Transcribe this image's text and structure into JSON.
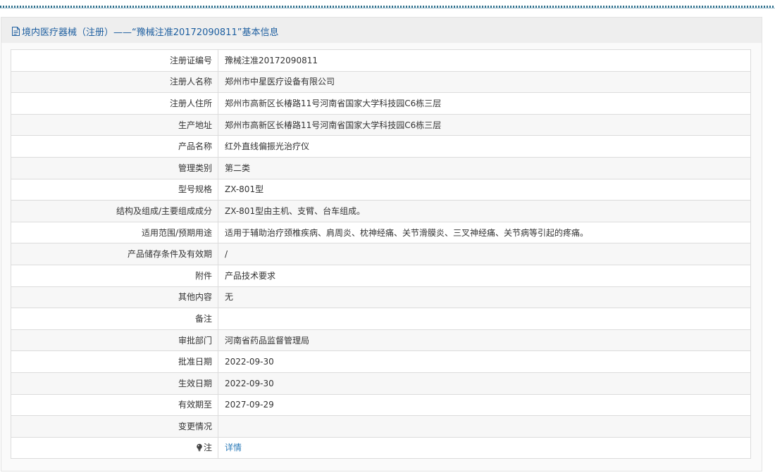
{
  "panel": {
    "title": "境内医疗器械（注册）——“豫械注准20172090811”基本信息",
    "title_icon": "document-icon"
  },
  "rows": [
    {
      "label": "注册证编号",
      "value": "豫械注准20172090811"
    },
    {
      "label": "注册人名称",
      "value": "郑州市中星医疗设备有限公司"
    },
    {
      "label": "注册人住所",
      "value": "郑州市高新区长椿路11号河南省国家大学科技园C6栋三层"
    },
    {
      "label": "生产地址",
      "value": "郑州市高新区长椿路11号河南省国家大学科技园C6栋三层"
    },
    {
      "label": "产品名称",
      "value": "红外直线偏振光治疗仪"
    },
    {
      "label": "管理类别",
      "value": "第二类"
    },
    {
      "label": "型号规格",
      "value": "ZX-801型"
    },
    {
      "label": "结构及组成/主要组成成分",
      "value": "ZX-801型由主机、支臂、台车组成。"
    },
    {
      "label": "适用范围/预期用途",
      "value": "适用于辅助治疗颈椎疾病、肩周炎、枕神经痛、关节滑膜炎、三叉神经痛、关节病等引起的疼痛。"
    },
    {
      "label": "产品储存条件及有效期",
      "value": "/"
    },
    {
      "label": "附件",
      "value": "产品技术要求"
    },
    {
      "label": "其他内容",
      "value": "无"
    },
    {
      "label": "备注",
      "value": ""
    },
    {
      "label": "审批部门",
      "value": "河南省药品监督管理局"
    },
    {
      "label": "批准日期",
      "value": "2022-09-30"
    },
    {
      "label": "生效日期",
      "value": "2022-09-30"
    },
    {
      "label": "有效期至",
      "value": "2027-09-29"
    },
    {
      "label": "变更情况",
      "value": ""
    }
  ],
  "note_row": {
    "label": "注",
    "icon": "lightbulb-icon",
    "link_text": "详情"
  },
  "colors": {
    "title": "#1e5fa0",
    "link": "#2a7ab8",
    "border": "#dcdcdc",
    "header_bg": "#eeeeee"
  }
}
